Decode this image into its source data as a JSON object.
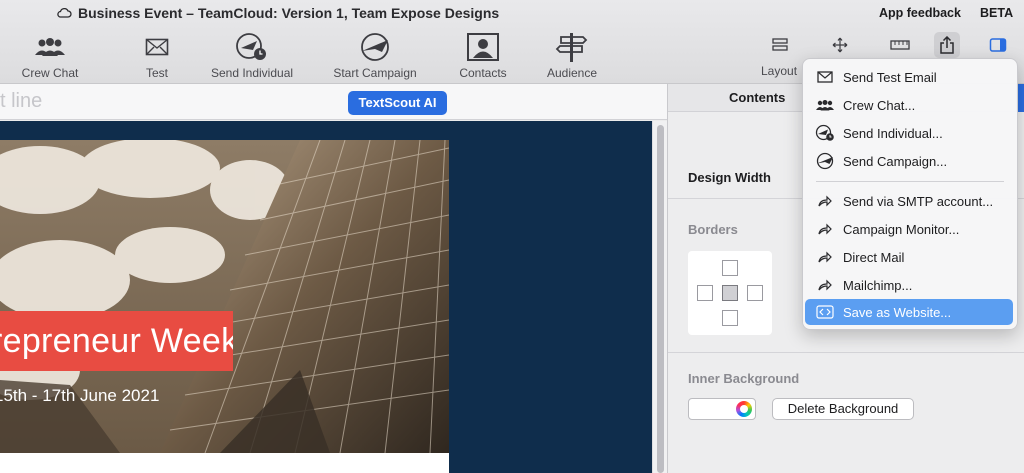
{
  "window": {
    "title": "Business Event – TeamCloud: Version 1, Team  Expose Designs",
    "app_feedback": "App feedback",
    "beta": "BETA"
  },
  "toolbar": {
    "items": [
      {
        "label": "Crew Chat",
        "icon": "people-icon"
      },
      {
        "label": "Test",
        "icon": "envelope-icon"
      },
      {
        "label": "Send Individual",
        "icon": "plane-clock-icon"
      },
      {
        "label": "Start Campaign",
        "icon": "plane-icon"
      },
      {
        "label": "Contacts",
        "icon": "contact-card-icon"
      },
      {
        "label": "Audience",
        "icon": "signpost-icon"
      }
    ],
    "layout_label": "Layout"
  },
  "editor": {
    "subject_partial": "t line",
    "textscout_label": "TextScout AI",
    "banner_text": "repreneur Week",
    "dates_text": "15th - 17th June 2021"
  },
  "panel": {
    "tab_contents": "Contents",
    "design_width": "Design Width",
    "borders": "Borders",
    "inner_background": "Inner Background",
    "delete_background": "Delete Background"
  },
  "menu": {
    "items": [
      {
        "label": "Send Test Email",
        "icon": "envelope-icon"
      },
      {
        "label": "Crew Chat...",
        "icon": "people-icon"
      },
      {
        "label": "Send Individual...",
        "icon": "plane-clock-icon"
      },
      {
        "label": "Send Campaign...",
        "icon": "plane-icon"
      },
      {
        "label": "Send via SMTP account...",
        "icon": "share-arrow-icon"
      },
      {
        "label": "Campaign Monitor...",
        "icon": "share-arrow-icon"
      },
      {
        "label": "Direct Mail",
        "icon": "share-arrow-icon"
      },
      {
        "label": "Mailchimp...",
        "icon": "share-arrow-icon"
      },
      {
        "label": "Save as Website...",
        "icon": "code-brackets-icon",
        "selected": true
      }
    ]
  },
  "colors": {
    "accent_blue": "#2a6de0",
    "menu_selection": "#5b9ef1",
    "banner_red": "#e84c42",
    "canvas_navy": "#0f2d4c"
  }
}
